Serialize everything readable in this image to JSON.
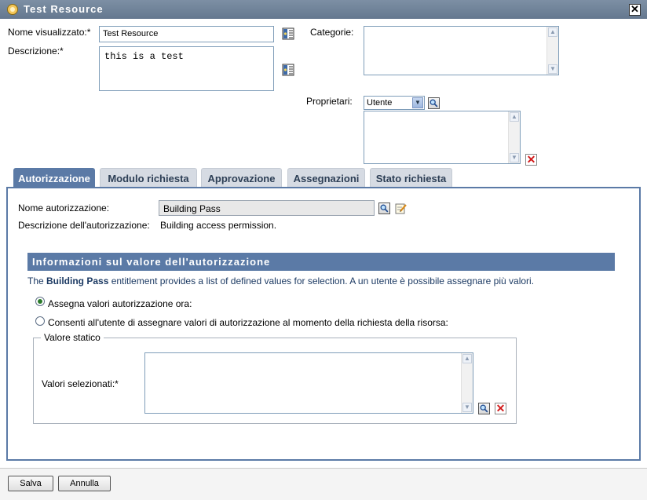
{
  "window": {
    "title": "Test Resource",
    "close_label": "✕"
  },
  "form": {
    "display_name_label": "Nome visualizzato:*",
    "display_name_value": "Test Resource",
    "description_label": "Descrizione:*",
    "description_value": "this is a test",
    "categories_label": "Categorie:",
    "owners_label": "Proprietari:",
    "owners_select_value": "Utente"
  },
  "tabs": [
    {
      "label": "Autorizzazione",
      "active": true
    },
    {
      "label": "Modulo richiesta",
      "active": false
    },
    {
      "label": "Approvazione",
      "active": false
    },
    {
      "label": "Assegnazioni",
      "active": false
    },
    {
      "label": "Stato richiesta",
      "active": false
    }
  ],
  "entitlement": {
    "name_label": "Nome autorizzazione:",
    "name_value": "Building Pass",
    "desc_label": "Descrizione dell'autorizzazione:",
    "desc_value": "Building access permission."
  },
  "value_info": {
    "header": "Informazioni sul valore dell'autorizzazione",
    "info_prefix": "The ",
    "info_bold": "Building Pass",
    "info_suffix": " entitlement provides a list of defined values for selection. A un utente è possibile assegnare più valori.",
    "radio1_label": "Assegna valori autorizzazione ora:",
    "radio2_label": "Consenti all'utente di assegnare valori di autorizzazione al momento della richiesta della risorsa:",
    "static_legend": "Valore statico",
    "selected_values_label": "Valori selezionati:*"
  },
  "buttons": {
    "save": "Salva",
    "cancel": "Annulla"
  },
  "colors": {
    "accent": "#5b7aa6",
    "titlebar": "#6f8299",
    "delete": "#d21a1a"
  }
}
